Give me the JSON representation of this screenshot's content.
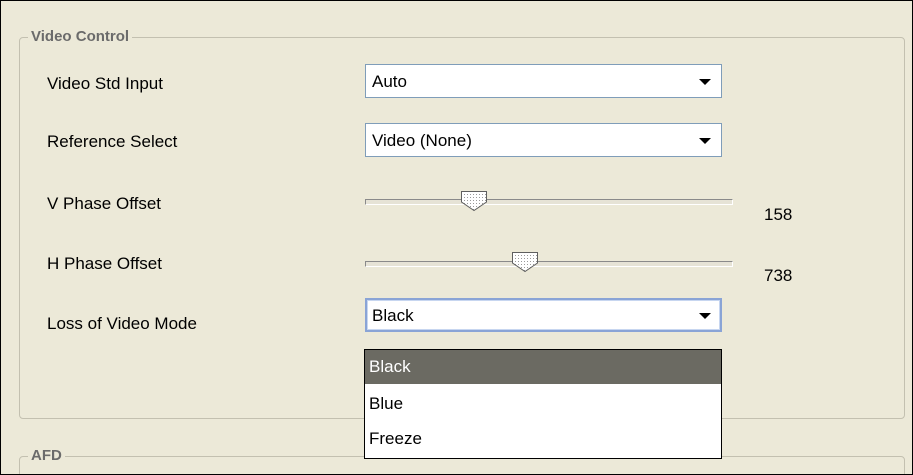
{
  "video_control": {
    "title": "Video Control",
    "video_std_input": {
      "label": "Video Std Input",
      "value": "Auto"
    },
    "reference_select": {
      "label": "Reference Select",
      "value": "Video (None)"
    },
    "v_phase_offset": {
      "label": "V Phase Offset",
      "value": "158"
    },
    "h_phase_offset": {
      "label": "H Phase Offset",
      "value": "738"
    },
    "loss_of_video_mode": {
      "label": "Loss of Video Mode",
      "value": "Black",
      "options": [
        "Black",
        "Blue",
        "Freeze"
      ],
      "highlighted_option": "Black"
    }
  },
  "afd": {
    "title": "AFD"
  },
  "colors": {
    "panel_background": "#ece9d8",
    "group_border": "#c3c0b0",
    "combo_border": "#7f9db9",
    "selected_item_background": "#6b6a62"
  },
  "icons": {
    "combo_arrow": "chevron-down-icon",
    "slider_thumb": "slider-thumb-icon"
  }
}
